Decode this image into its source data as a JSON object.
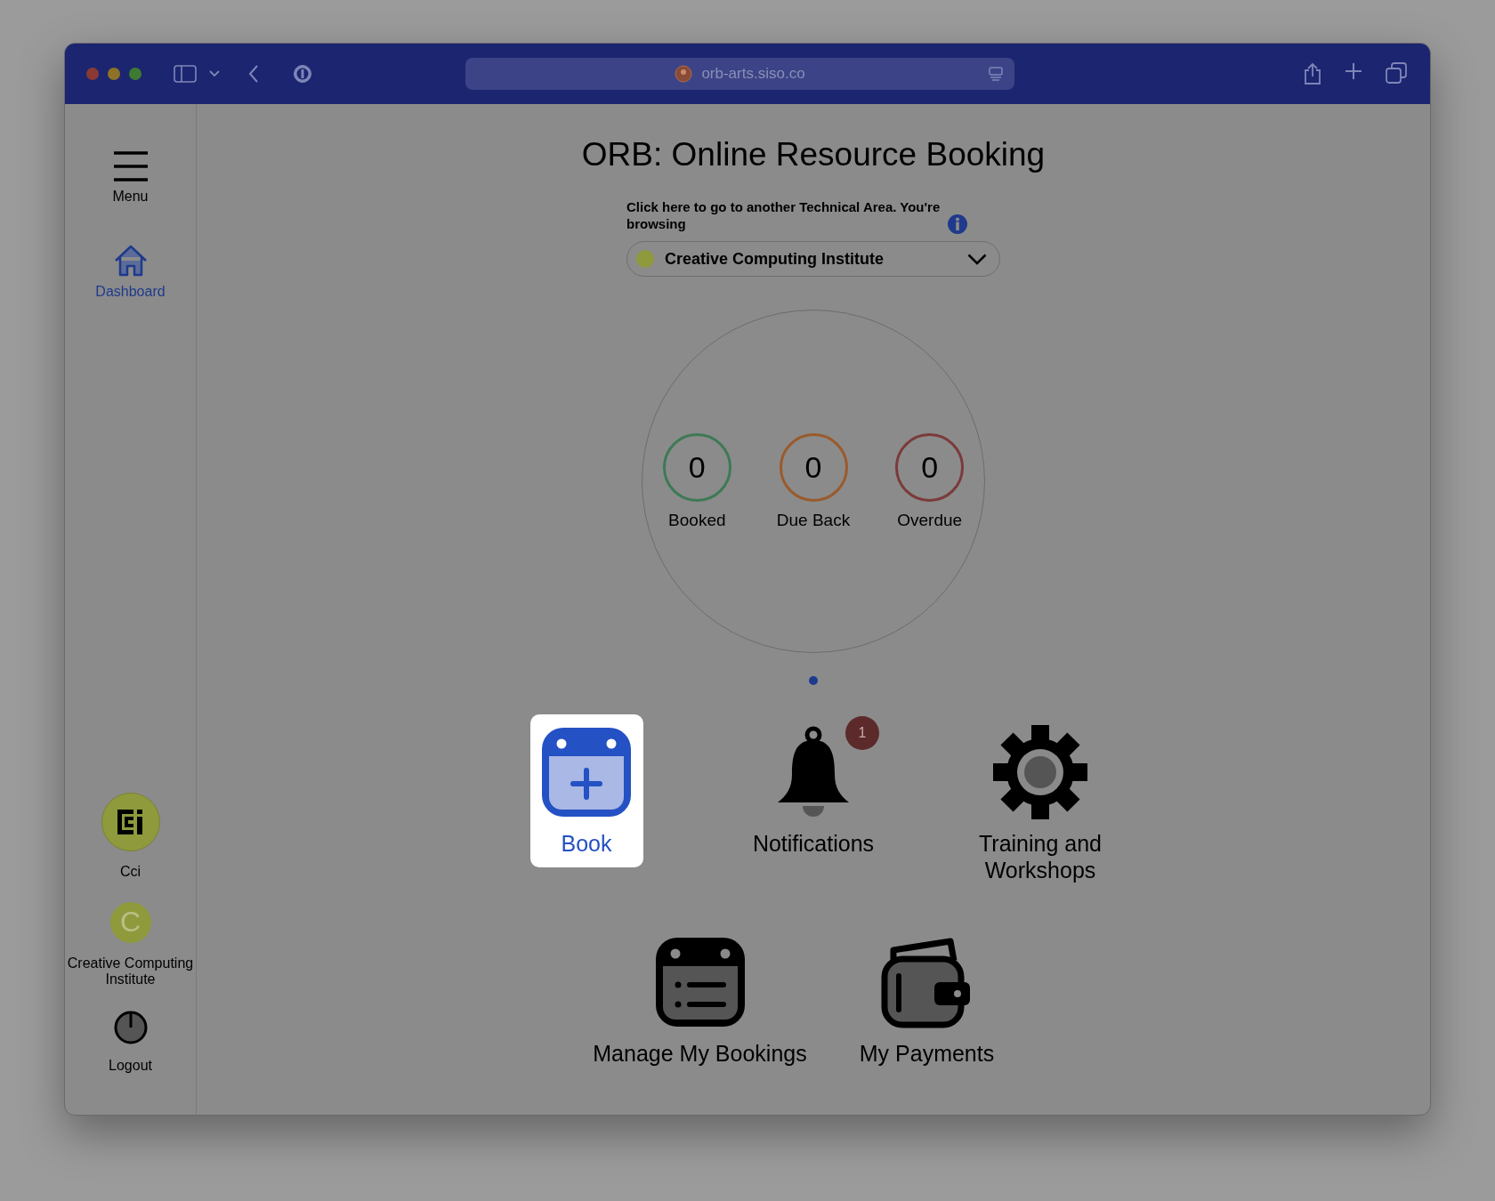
{
  "browser": {
    "url": "orb-arts.siso.co"
  },
  "sidebar": {
    "items": [
      {
        "kind": "menu",
        "label": "Menu",
        "selected": false
      },
      {
        "kind": "home",
        "label": "Dashboard",
        "selected": true
      }
    ],
    "bottom_items": [
      {
        "kind": "logo-avatar",
        "label": "Cci"
      },
      {
        "kind": "letter-avatar",
        "initial": "C",
        "label": "Creative Computing Institute"
      },
      {
        "kind": "power",
        "label": "Logout"
      }
    ]
  },
  "title": "ORB: Online Resource Booking",
  "area_prompt": "Click here to go to another Technical Area. You're browsing",
  "area_select": {
    "value": "Creative Computing Institute",
    "color": "#8f9a3c"
  },
  "stats": [
    {
      "value": "0",
      "label": "Booked",
      "color": "#3d7a55"
    },
    {
      "value": "0",
      "label": "Due Back",
      "color": "#9a5a2c"
    },
    {
      "value": "0",
      "label": "Overdue",
      "color": "#7c3a3a"
    }
  ],
  "pager": [
    {
      "selected": true
    }
  ],
  "tiles": [
    {
      "kind": "calendar-add",
      "label": "Book",
      "highlighted": true
    },
    {
      "kind": "bell",
      "label": "Notifications",
      "highlighted": false,
      "badge": "1"
    },
    {
      "kind": "gear",
      "label": "Training and Workshops",
      "highlighted": false
    },
    {
      "kind": "calendar-list",
      "label": "Manage My Bookings",
      "highlighted": false
    },
    {
      "kind": "wallet",
      "label": "My Payments",
      "highlighted": false
    }
  ]
}
